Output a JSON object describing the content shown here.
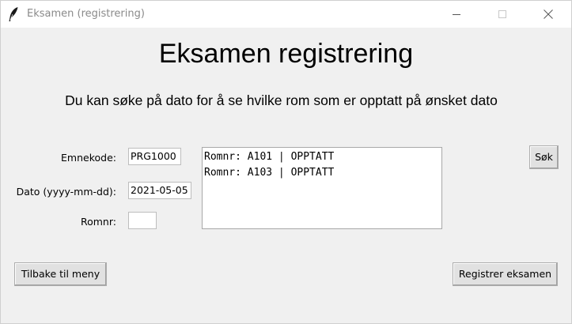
{
  "window": {
    "title": "Eksamen (registrering)",
    "app_icon": "feather-icon",
    "controls": [
      "minimize-icon",
      "maximize-icon",
      "close-icon"
    ]
  },
  "main": {
    "heading": "Eksamen registrering",
    "subtitle": "Du kan søke på dato for å se hvilke rom som er opptatt på ønsket dato"
  },
  "form": {
    "emnekode_label": "Emnekode:",
    "emnekode_value": "PRG1000",
    "dato_label": "Dato (yyyy-mm-dd):",
    "dato_value": "2021-05-05",
    "romnr_label": "Romnr:",
    "romnr_value": ""
  },
  "results": {
    "lines": [
      "Romnr: A101 | OPPTATT",
      "Romnr: A103 | OPPTATT"
    ]
  },
  "buttons": {
    "search_label": "Søk",
    "back_label": "Tilbake til meny",
    "register_label": "Registrer eksamen"
  }
}
